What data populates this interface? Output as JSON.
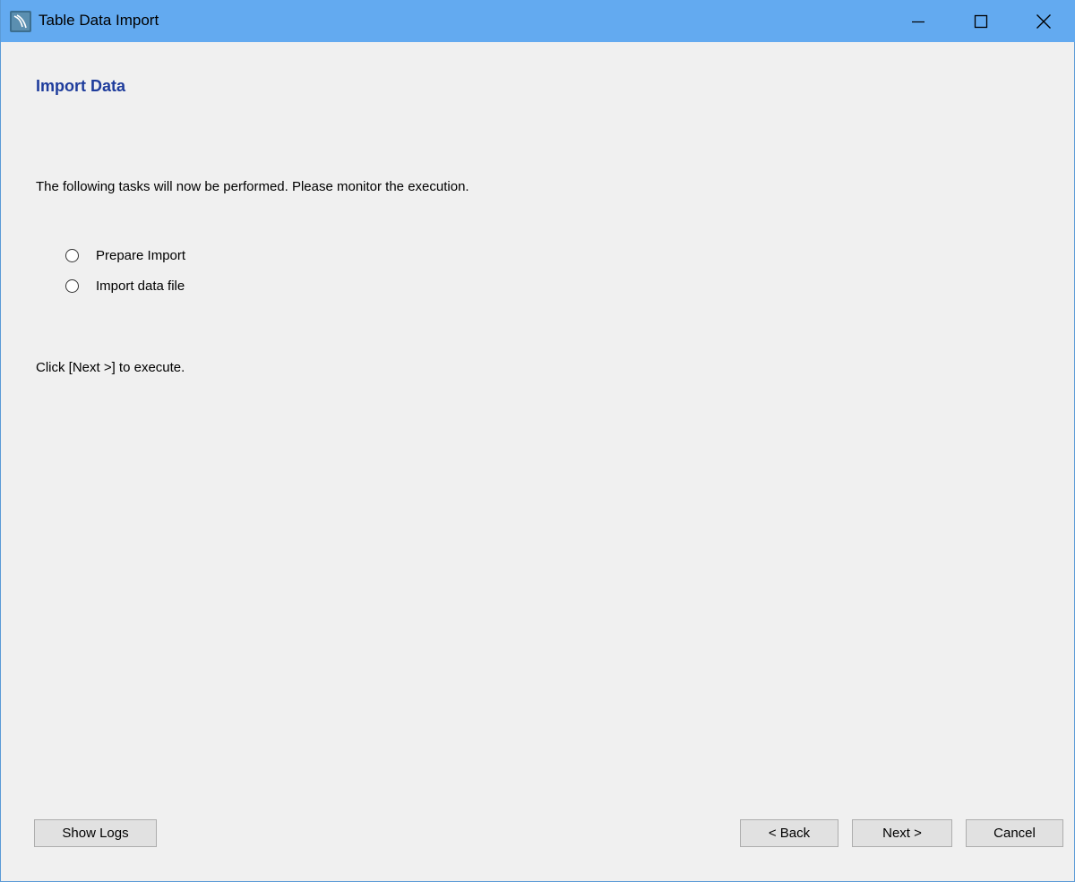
{
  "window": {
    "title": "Table Data Import",
    "icon": "mysql-workbench-icon",
    "controls": {
      "minimize": "minimize-icon",
      "maximize": "maximize-icon",
      "close": "close-icon"
    },
    "titlebar_color": "#63aaf0"
  },
  "page": {
    "heading": "Import Data",
    "heading_color": "#1e3c9c",
    "intro": "The following tasks will now be performed. Please monitor the execution.",
    "tasks": [
      {
        "label": "Prepare Import",
        "status": "pending"
      },
      {
        "label": "Import data file",
        "status": "pending"
      }
    ],
    "hint": "Click [Next >] to execute."
  },
  "footer": {
    "show_logs": "Show Logs",
    "back": "< Back",
    "next": "Next >",
    "cancel": "Cancel"
  }
}
